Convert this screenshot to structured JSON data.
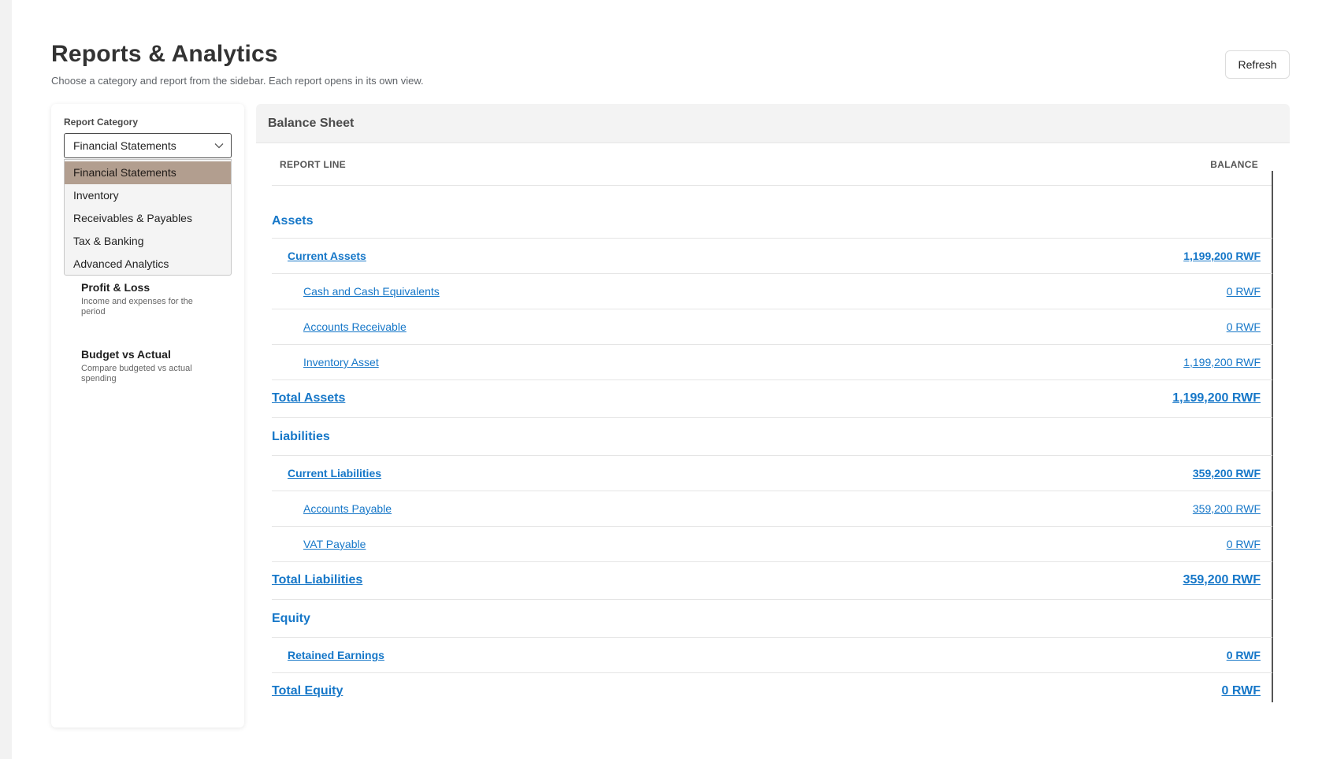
{
  "page": {
    "title": "Reports & Analytics",
    "subtitle": "Choose a category and report from the sidebar. Each report opens in its own view.",
    "refresh_label": "Refresh"
  },
  "sidebar": {
    "category_label": "Report Category",
    "selected_category": "Financial Statements",
    "categories": [
      "Financial Statements",
      "Inventory",
      "Receivables & Payables",
      "Tax & Banking",
      "Advanced Analytics"
    ],
    "reports": [
      {
        "title": "Profit & Loss",
        "description": "Income and expenses for the period"
      },
      {
        "title": "Budget vs Actual",
        "description": "Compare budgeted vs actual spending"
      }
    ]
  },
  "report": {
    "title": "Balance Sheet",
    "col_line": "REPORT LINE",
    "col_balance": "BALANCE",
    "rows": [
      {
        "label": "Assets",
        "value": ""
      },
      {
        "label": "Current Assets",
        "value": "1,199,200 RWF"
      },
      {
        "label": "Cash and Cash Equivalents",
        "value": "0 RWF"
      },
      {
        "label": "Accounts Receivable",
        "value": "0 RWF"
      },
      {
        "label": "Inventory Asset",
        "value": "1,199,200 RWF"
      },
      {
        "label": "Total Assets",
        "value": "1,199,200 RWF"
      },
      {
        "label": "Liabilities",
        "value": ""
      },
      {
        "label": "Current Liabilities",
        "value": "359,200 RWF"
      },
      {
        "label": "Accounts Payable",
        "value": "359,200 RWF"
      },
      {
        "label": "VAT Payable",
        "value": "0 RWF"
      },
      {
        "label": "Total Liabilities",
        "value": "359,200 RWF"
      },
      {
        "label": "Equity",
        "value": ""
      },
      {
        "label": "Retained Earnings",
        "value": "0 RWF"
      },
      {
        "label": "Total Equity",
        "value": "0 RWF"
      }
    ]
  },
  "colors": {
    "link": "#1677c8",
    "selected_option_bg": "#b29e8f"
  }
}
